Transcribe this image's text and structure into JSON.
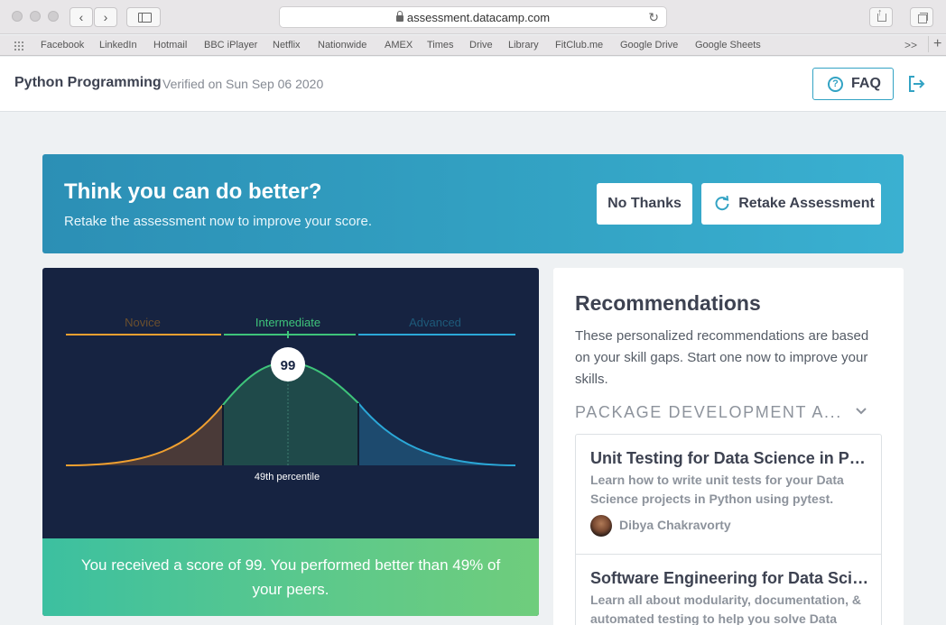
{
  "browser": {
    "url": "assessment.datacamp.com",
    "bookmarks": [
      "Facebook",
      "LinkedIn",
      "Hotmail",
      "BBC iPlayer",
      "Netflix",
      "Nationwide",
      "AMEX",
      "Times",
      "Drive",
      "Library",
      "FitClub.me",
      "Google Drive",
      "Google Sheets"
    ],
    "more_label": ">>",
    "add_label": "+"
  },
  "header": {
    "course_title": "Python Programming",
    "verified_text": "Verified on Sun Sep 06 2020",
    "faq_label": "FAQ",
    "faq_icon_glyph": "?",
    "accent_color": "#33a3c4"
  },
  "banner": {
    "title": "Think you can do better?",
    "subtitle": "Retake the assessment now to improve your score.",
    "no_thanks_label": "No Thanks",
    "retake_label": "Retake Assessment"
  },
  "score": {
    "levels": {
      "novice": "Novice",
      "intermediate": "Intermediate",
      "advanced": "Advanced"
    },
    "value": "99",
    "percentile_label": "49th percentile",
    "percentile": 49,
    "message": "You received a score of 99. You performed better than 49% of your peers.",
    "colors": {
      "novice": "#f0a030",
      "intermediate": "#3ec47a",
      "advanced": "#2ba8d8",
      "background": "#162341"
    }
  },
  "recommendations": {
    "title": "Recommendations",
    "description": "These personalized recommendations are based on your skill gaps. Start one now to improve your skills.",
    "category": "PACKAGE DEVELOPMENT A...",
    "courses": [
      {
        "title": "Unit Testing for Data Science in Pyth...",
        "description": "Learn how to write unit tests for your Data Science projects in Python using pytest.",
        "author": "Dibya Chakravorty"
      },
      {
        "title": "Software Engineering for Data Scien...",
        "description": "Learn all about modularity, documentation, & automated testing to help you solve Data Science"
      }
    ]
  }
}
